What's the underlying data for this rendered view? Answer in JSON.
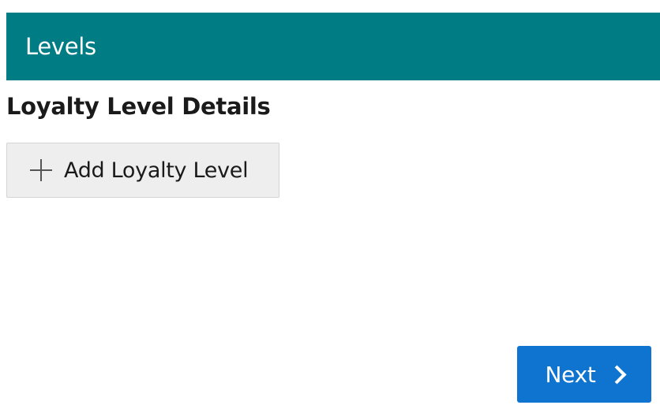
{
  "header": {
    "title": "Levels",
    "background_color": "#007C84"
  },
  "section": {
    "title": "Loyalty Level Details"
  },
  "add_button": {
    "label": "Add Loyalty Level",
    "icon": "plus-icon"
  },
  "next_button": {
    "label": "Next",
    "icon": "chevron-right-icon",
    "background_color": "#0F74D0"
  }
}
